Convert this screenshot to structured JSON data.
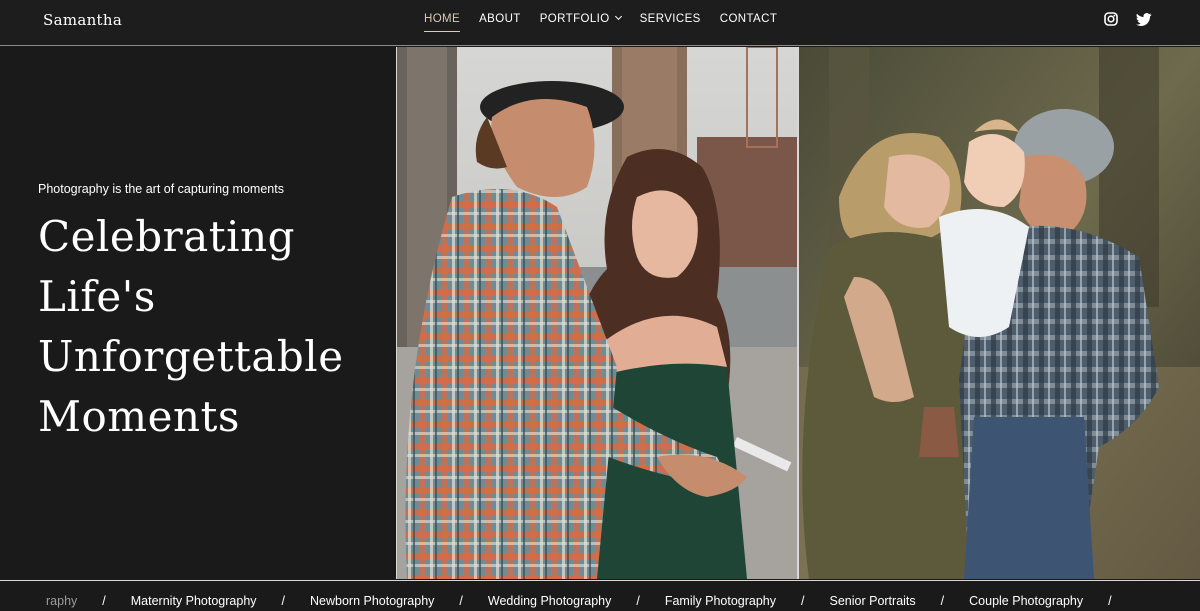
{
  "brand": "Samantha",
  "nav": {
    "items": [
      {
        "label": "HOME"
      },
      {
        "label": "ABOUT"
      },
      {
        "label": "PORTFOLIO"
      },
      {
        "label": "SERVICES"
      },
      {
        "label": "CONTACT"
      }
    ],
    "active": "HOME"
  },
  "social": {
    "icons": [
      "instagram-icon",
      "twitter-icon"
    ]
  },
  "hero": {
    "tagline": "Photography is the art of capturing moments",
    "headline_lines": [
      "Celebrating",
      "Life's",
      "Unforgettable",
      "Moments"
    ]
  },
  "ticker": {
    "items": [
      "raphy",
      "Maternity Photography",
      "Newborn Photography",
      "Wedding Photography",
      "Family Photography",
      "Senior Portraits",
      "Couple Photography"
    ],
    "separator": "/"
  },
  "colors": {
    "background": "#1b1a1b",
    "accent": "#d9cbb2",
    "text": "#ffffff"
  }
}
